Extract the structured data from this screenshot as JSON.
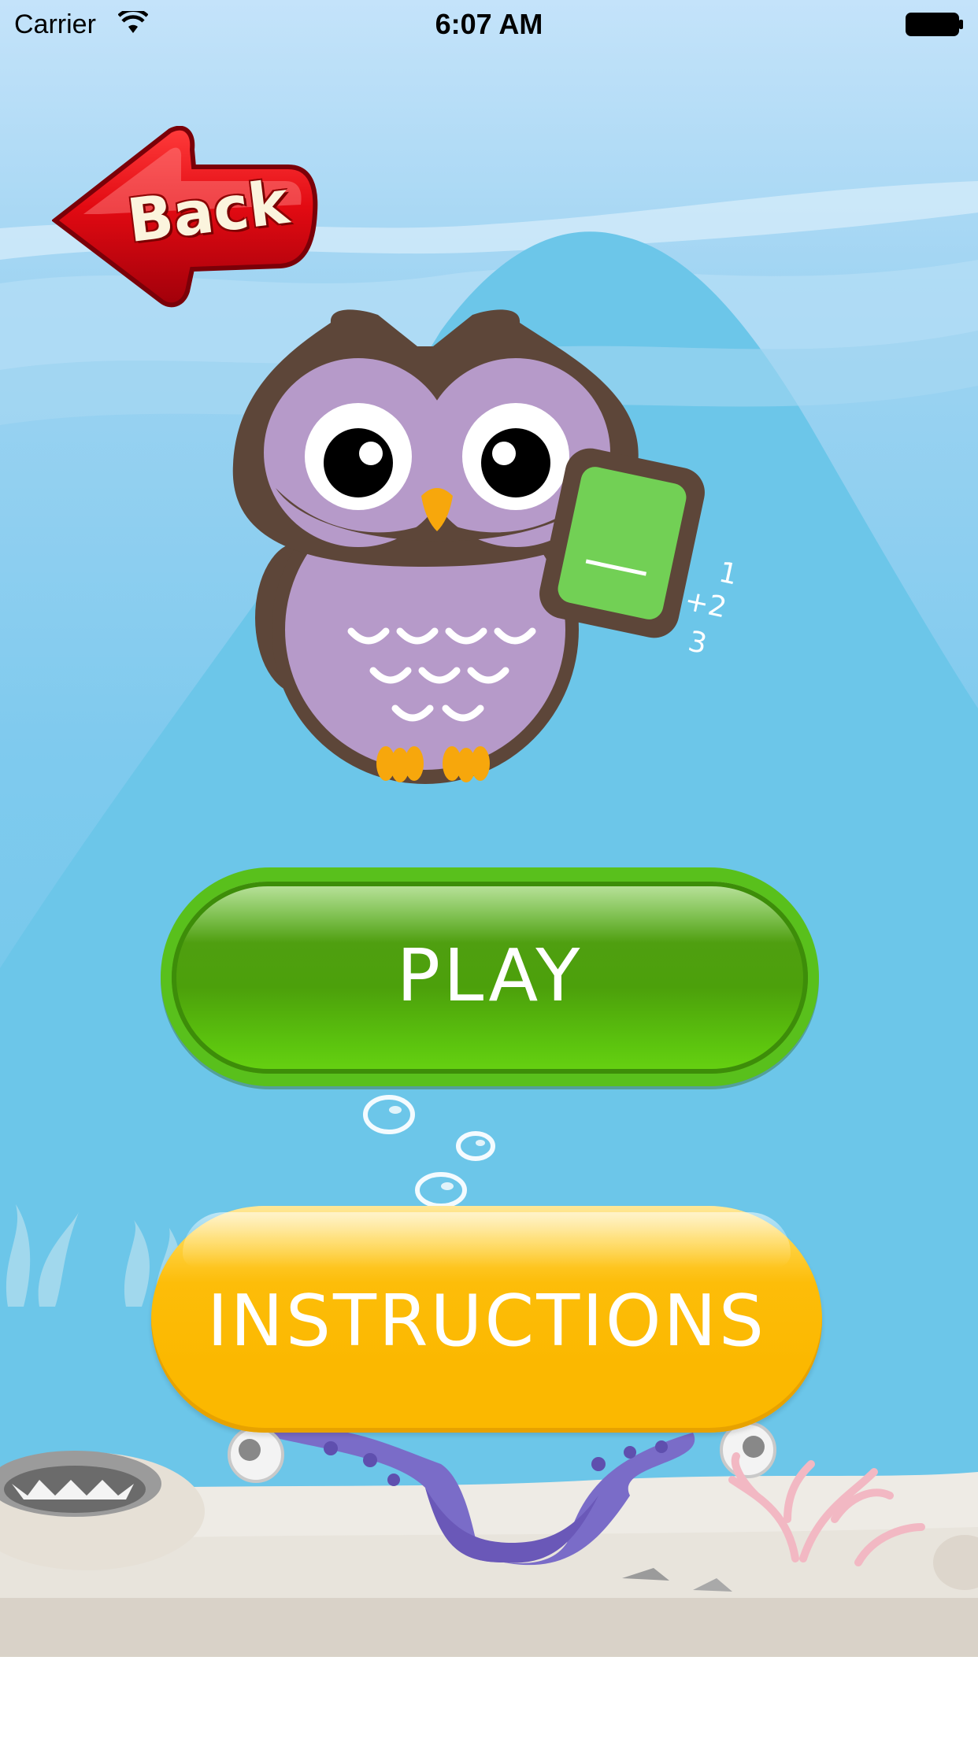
{
  "status_bar": {
    "carrier": "Carrier",
    "time": "6:07 AM"
  },
  "back_button": {
    "label": "Back"
  },
  "mascot": {
    "icon": "owl-mascot-icon",
    "card_lines": [
      "1",
      "+2",
      "3"
    ]
  },
  "menu": {
    "play_label": "PLAY",
    "instructions_label": "INSTRUCTIONS"
  },
  "colors": {
    "play_green": "#4ca00b",
    "instructions_yellow": "#fbb800",
    "back_red": "#d40812",
    "owl_purple": "#b69ac9",
    "owl_brown": "#5d4639"
  }
}
